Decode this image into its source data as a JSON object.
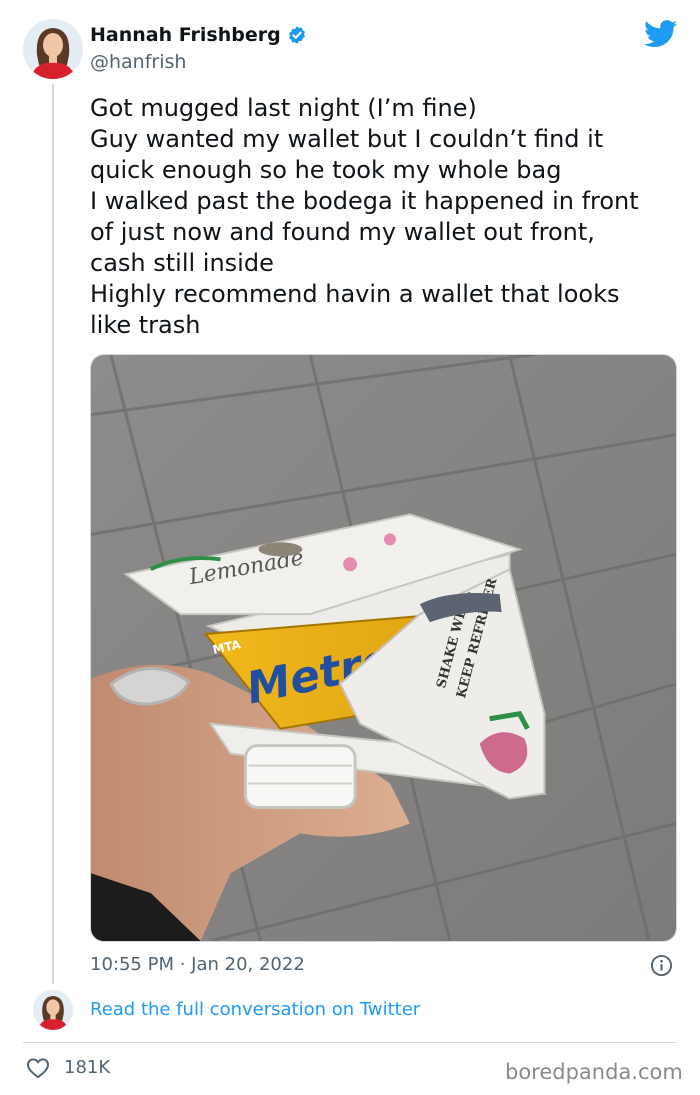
{
  "user": {
    "name": "Hannah Frishberg",
    "handle": "@hanfrish",
    "verified": true,
    "avatar_icon": "user-avatar"
  },
  "tweet": {
    "lines": [
      "Got mugged last night (I’m fine)",
      "Guy wanted my wallet but I couldn’t find it",
      "quick enough so he took my whole bag",
      "I walked past the bodega it happened in front",
      "of just now and found my wallet out front,",
      "cash still inside",
      "Highly recommend havin a wallet that looks",
      "like trash"
    ],
    "timestamp": "10:55 PM · Jan 20, 2022",
    "read_more": "Read the full conversation on Twitter"
  },
  "photo": {
    "label": "Hand holding a wallet made from a lemonade carton with a MetroCard inside",
    "carton_text": [
      "Lemonade",
      "SHAKE WELL",
      "KEEP REFRIGER",
      "MetroCard",
      "MTA"
    ]
  },
  "footer": {
    "likes": "181K",
    "watermark": "boredpanda.com"
  },
  "colors": {
    "twitter_blue": "#1d9bf0",
    "text": "#0f1419",
    "secondary": "#536471",
    "divider": "#cfd9de"
  }
}
